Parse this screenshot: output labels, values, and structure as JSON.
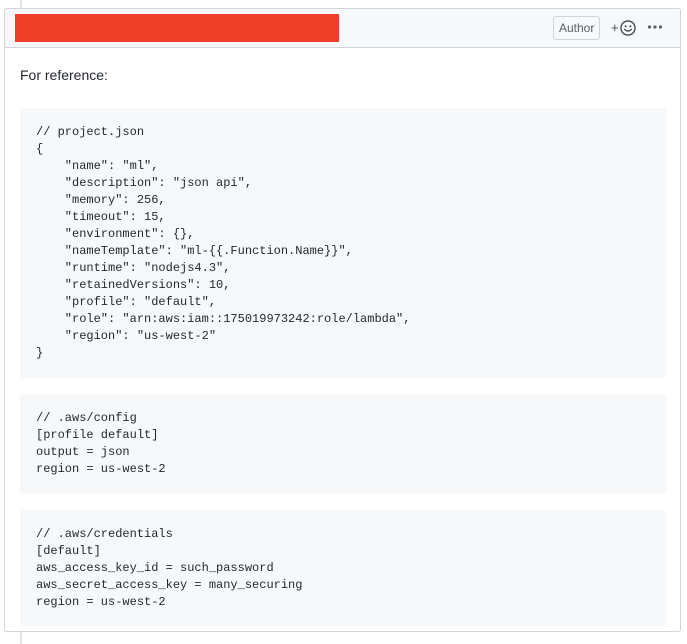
{
  "comment": {
    "author_badge": "Author",
    "reaction_button": {
      "plus": "+",
      "icon": "smiley-icon"
    },
    "more_actions_icon": "kebab-horizontal-icon",
    "redaction_color": "#ee4029",
    "body": {
      "intro": "For reference:",
      "code_blocks": [
        {
          "lines": [
            "// project.json",
            "{",
            "    \"name\": \"ml\",",
            "    \"description\": \"json api\",",
            "    \"memory\": 256,",
            "    \"timeout\": 15,",
            "    \"environment\": {},",
            "    \"nameTemplate\": \"ml-{{.Function.Name}}\",",
            "    \"runtime\": \"nodejs4.3\",",
            "    \"retainedVersions\": 10,",
            "    \"profile\": \"default\",",
            "    \"role\": \"arn:aws:iam::175019973242:role/lambda\",",
            "    \"region\": \"us-west-2\"",
            "}"
          ]
        },
        {
          "lines": [
            "// .aws/config",
            "[profile default]",
            "output = json",
            "region = us-west-2"
          ]
        },
        {
          "lines": [
            "// .aws/credentials",
            "[default]",
            "aws_access_key_id = such_password",
            "aws_secret_access_key = many_securing",
            "region = us-west-2"
          ]
        }
      ]
    }
  }
}
